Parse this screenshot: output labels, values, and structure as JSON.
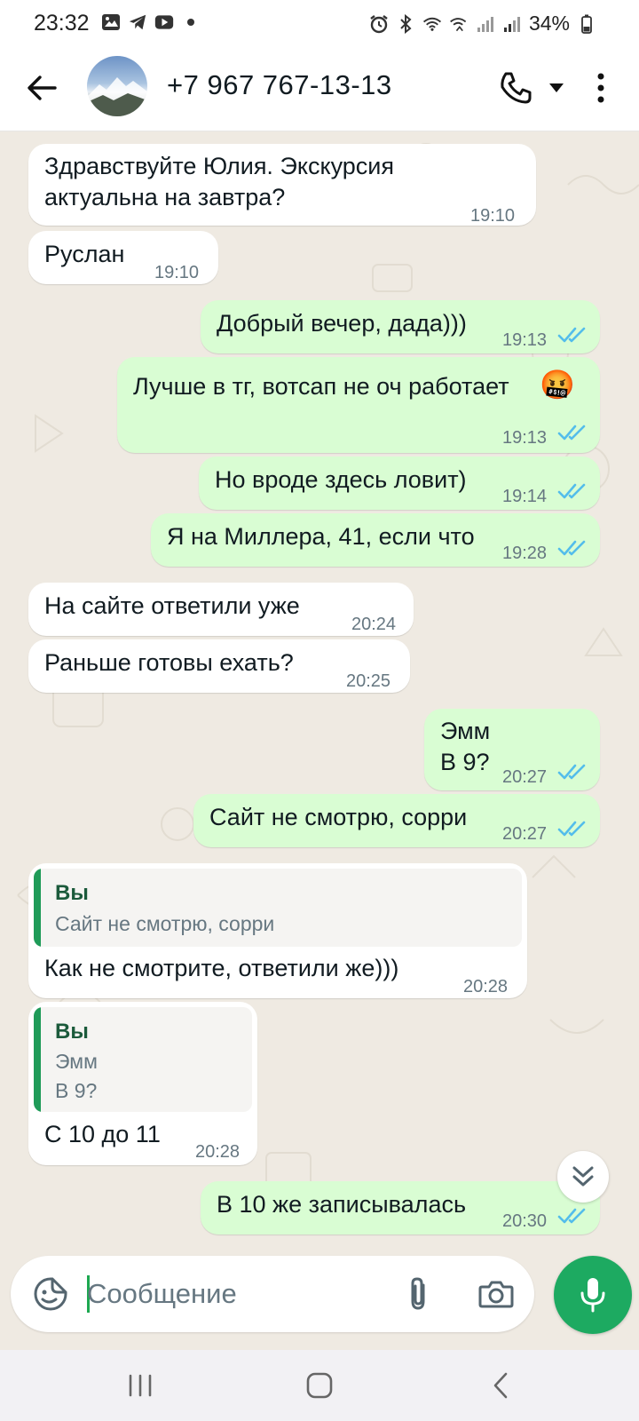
{
  "status_bar": {
    "time": "23:32",
    "battery": "34%",
    "left_icons": [
      "gallery-icon",
      "telegram-icon",
      "youtube-icon",
      "dot-icon"
    ],
    "right_icons": [
      "alarm-icon",
      "bluetooth-icon",
      "wifi-icon",
      "wifi-call-icon",
      "signal-icon",
      "signal-icon",
      "battery-icon"
    ]
  },
  "header": {
    "contact_name": "+7 967 767-13-13",
    "icons": [
      "back-arrow-icon",
      "phone-icon",
      "caret-down-icon",
      "more-vert-icon"
    ]
  },
  "messages": [
    {
      "dir": "in",
      "text": "Здравствуйте Юлия. Экскурсия\nактуальна на завтра?",
      "time": "19:10"
    },
    {
      "dir": "in",
      "text": "Руслан",
      "time": "19:10"
    },
    {
      "dir": "out",
      "text": "Добрый вечер, дада)))",
      "time": "19:13",
      "status": "read"
    },
    {
      "dir": "out",
      "text": "Лучше в тг, вотсап не оч работает",
      "emoji": "🤬",
      "time": "19:13",
      "status": "read"
    },
    {
      "dir": "out",
      "text": "Но вроде здесь ловит)",
      "time": "19:14",
      "status": "read"
    },
    {
      "dir": "out",
      "text": "Я на Миллера, 41, если что",
      "time": "19:28",
      "status": "read"
    },
    {
      "dir": "in",
      "text": "На сайте ответили уже",
      "time": "20:24"
    },
    {
      "dir": "in",
      "text": "Раньше готовы ехать?",
      "time": "20:25"
    },
    {
      "dir": "out",
      "text": "Эмм\nВ 9?",
      "time": "20:27",
      "status": "read"
    },
    {
      "dir": "out",
      "text": "Сайт не смотрю, сорри",
      "time": "20:27",
      "status": "read"
    },
    {
      "dir": "in",
      "quote": {
        "author": "Вы",
        "text": "Сайт не смотрю, сорри"
      },
      "text": "Как не смотрите, ответили же)))",
      "time": "20:28"
    },
    {
      "dir": "in",
      "quote": {
        "author": "Вы",
        "text": "Эмм\nВ 9?"
      },
      "text": "С 10 до 11",
      "time": "20:28"
    },
    {
      "dir": "out",
      "text": "В 10 же записывалась",
      "time": "20:30",
      "status": "read"
    }
  ],
  "composer": {
    "placeholder": "Сообщение",
    "value": "",
    "icons": [
      "sticker-icon",
      "attach-icon",
      "camera-icon",
      "mic-icon"
    ]
  },
  "scroll_button_icon": "double-chevron-down-icon",
  "nav_bar": {
    "icons": [
      "recent-apps-icon",
      "home-icon",
      "back-icon"
    ]
  },
  "colors": {
    "incoming_bubble": "#ffffff",
    "outgoing_bubble": "#d9fdd3",
    "chat_background": "#efeae2",
    "read_ticks": "#53bdeb",
    "accent_green": "#1daa61",
    "quote_bar": "#1f9b58"
  }
}
